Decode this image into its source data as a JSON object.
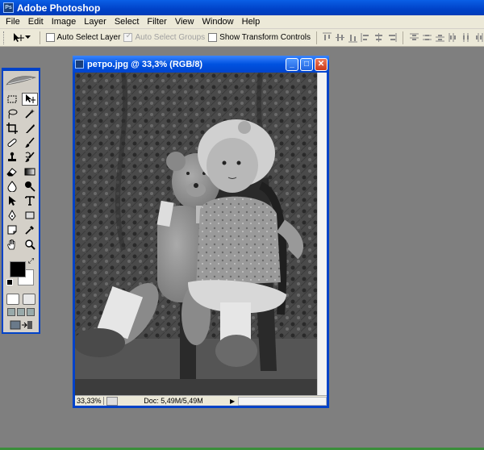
{
  "app": {
    "title": "Adobe Photoshop",
    "logo_text": "Ps"
  },
  "menu": [
    "File",
    "Edit",
    "Image",
    "Layer",
    "Select",
    "Filter",
    "View",
    "Window",
    "Help"
  ],
  "options": {
    "auto_select_layer": "Auto Select Layer",
    "auto_select_groups": "Auto Select Groups",
    "show_transform_controls": "Show Transform Controls"
  },
  "tools": [
    {
      "name": "marquee-tool",
      "icon": "marquee-icon"
    },
    {
      "name": "move-tool",
      "icon": "move-icon",
      "active": true
    },
    {
      "name": "lasso-tool",
      "icon": "lasso-icon"
    },
    {
      "name": "magic-wand-tool",
      "icon": "magic-wand-icon"
    },
    {
      "name": "crop-tool",
      "icon": "crop-icon"
    },
    {
      "name": "slice-tool",
      "icon": "slice-icon"
    },
    {
      "name": "healing-brush-tool",
      "icon": "bandage-icon"
    },
    {
      "name": "brush-tool",
      "icon": "brush-icon"
    },
    {
      "name": "clone-stamp-tool",
      "icon": "stamp-icon"
    },
    {
      "name": "history-brush-tool",
      "icon": "history-brush-icon"
    },
    {
      "name": "eraser-tool",
      "icon": "eraser-icon"
    },
    {
      "name": "gradient-tool",
      "icon": "gradient-icon"
    },
    {
      "name": "blur-tool",
      "icon": "blur-drop-icon"
    },
    {
      "name": "dodge-tool",
      "icon": "dodge-icon"
    },
    {
      "name": "path-selection-tool",
      "icon": "arrow-icon"
    },
    {
      "name": "type-tool",
      "icon": "type-icon"
    },
    {
      "name": "pen-tool",
      "icon": "pen-icon"
    },
    {
      "name": "shape-tool",
      "icon": "rectangle-icon"
    },
    {
      "name": "notes-tool",
      "icon": "note-icon"
    },
    {
      "name": "eyedropper-tool",
      "icon": "eyedropper-icon"
    },
    {
      "name": "hand-tool",
      "icon": "hand-icon"
    },
    {
      "name": "zoom-tool",
      "icon": "magnifier-icon"
    }
  ],
  "colors": {
    "foreground": "#000000",
    "background": "#ffffff",
    "title_blue": "#0052e0"
  },
  "document": {
    "title": "ретро.jpg @ 33,3% (RGB/8)",
    "zoom": "33,33%",
    "doc_size": "Doc: 5,49M/5,49M",
    "minimize": "_",
    "maximize": "□",
    "close": "✕"
  }
}
